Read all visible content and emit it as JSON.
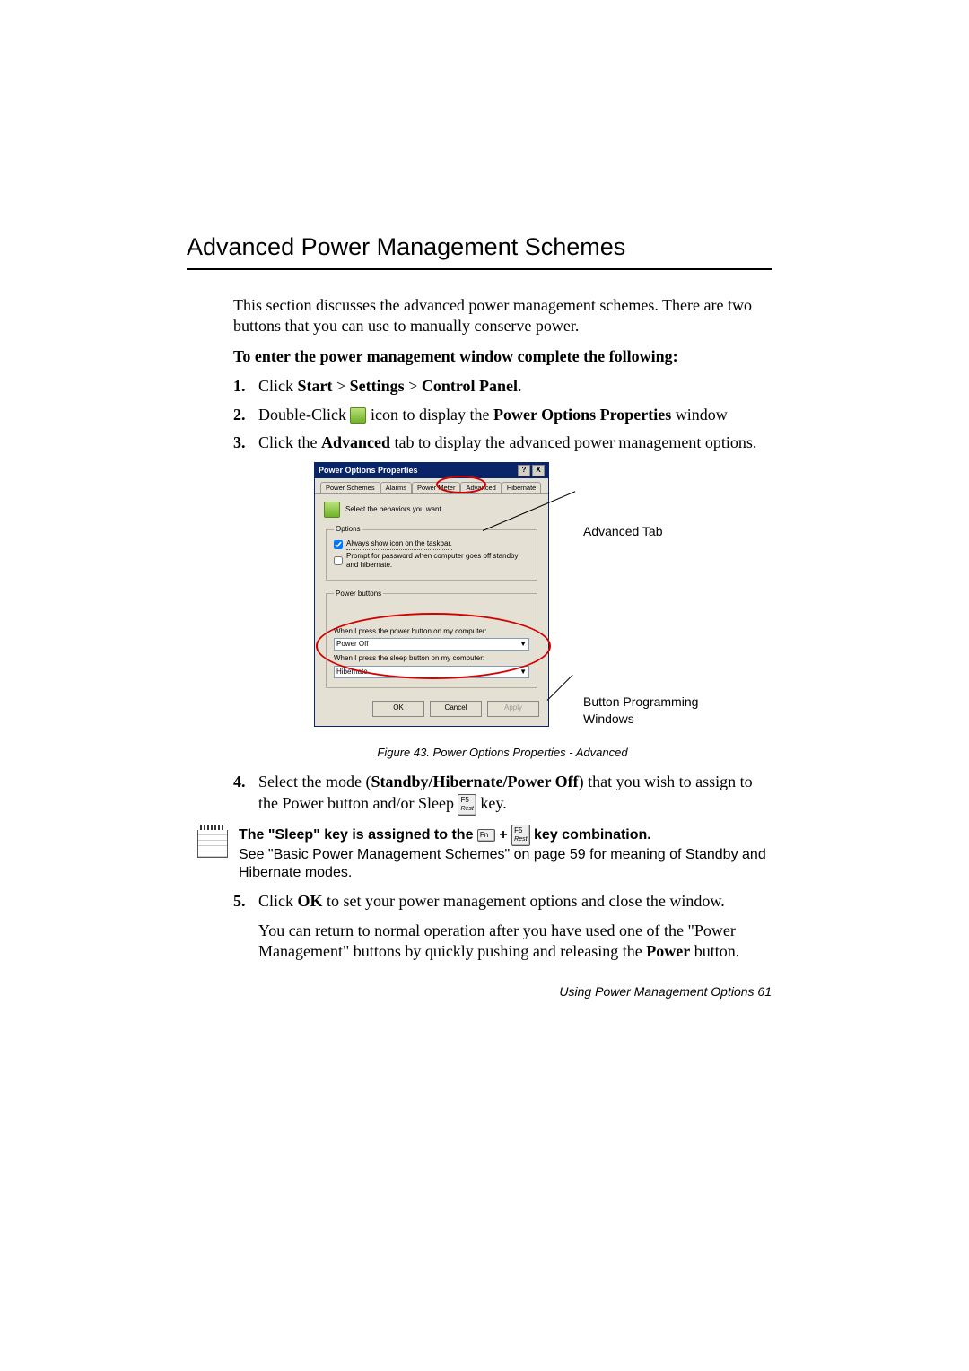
{
  "section_title": "Advanced Power Management Schemes",
  "intro": "This section discusses the advanced power management schemes. There are two buttons that you can use to manually conserve power.",
  "subheading": "To enter the power management window complete the following:",
  "steps": {
    "s1": {
      "num": "1.",
      "pre": "Click ",
      "b1": "Start",
      "gt1": " > ",
      "b2": "Settings",
      "gt2": " > ",
      "b3": "Control Panel",
      "post": "."
    },
    "s2": {
      "num": "2.",
      "pre": "Double-Click ",
      "mid": " icon to display the ",
      "b1": "Power Options Properties",
      "post": " window"
    },
    "s3": {
      "num": "3.",
      "pre": "Click the ",
      "b1": "Advanced",
      "post": " tab to display the advanced power management options."
    },
    "s4": {
      "num": "4.",
      "pre": "Select the mode (",
      "b1": "Standby/Hibernate/Power Off",
      "mid": ") that you wish to assign to the Power button and/or Sleep ",
      "post": " key."
    },
    "s5": {
      "num": "5.",
      "pre": "Click ",
      "b1": "OK",
      "post": " to set your power management options and close the window."
    }
  },
  "s5_follow_a": "You can return to normal operation after you have used one of the \"Power Management\" buttons by quickly pushing and releasing the ",
  "s5_follow_bold": "Power",
  "s5_follow_b": " button.",
  "figure_caption": "Figure 43.   Power Options Properties - Advanced",
  "callouts": {
    "advanced_tab": "Advanced Tab",
    "button_programming": "Button Programming Windows"
  },
  "dialog": {
    "title": "Power Options Properties",
    "help_btn": "?",
    "close_btn": "X",
    "tabs": [
      "Power Schemes",
      "Alarms",
      "Power Meter",
      "Advanced",
      "Hibernate"
    ],
    "header_text": "Select the behaviors you want.",
    "options_legend": "Options",
    "chk1": "Always show icon on the taskbar.",
    "chk2": "Prompt for password when computer goes off standby and hibernate.",
    "buttons_legend": "Power buttons",
    "label1": "When I press the power button on my computer:",
    "select1": "Power Off",
    "label2": "When I press the sleep button on my computer:",
    "select2": "Hibernate",
    "ok": "OK",
    "cancel": "Cancel",
    "apply": "Apply"
  },
  "note": {
    "line1_a": "The \"Sleep\" key is assigned to the ",
    "plus": " + ",
    "line1_b": " key combination.",
    "line2": "See  \"Basic Power Management Schemes\" on page 59 for meaning of Standby and Hibernate modes."
  },
  "keys": {
    "fn": "Fn",
    "f5_top": "F5",
    "f5_bot": "Rest"
  },
  "footer": "Using Power Management Options   61"
}
